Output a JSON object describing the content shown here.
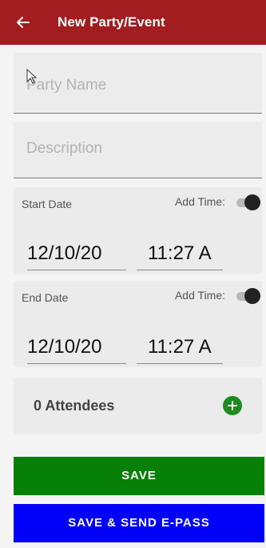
{
  "header": {
    "title": "New Party/Event",
    "back_icon": "arrow-left-icon",
    "color": "#a11d20"
  },
  "form": {
    "party_name": {
      "value": "",
      "placeholder": "Party Name"
    },
    "description": {
      "value": "",
      "placeholder": "Description"
    },
    "start": {
      "label": "Start Date",
      "add_time_label": "Add Time:",
      "add_time_on": true,
      "date": "12/10/20",
      "time": "11:27 A"
    },
    "end": {
      "label": "End Date",
      "add_time_label": "Add Time:",
      "add_time_on": true,
      "date": "12/10/20",
      "time": "11:27 A"
    },
    "attendees": {
      "label": "0 Attendees",
      "add_icon": "plus-icon"
    }
  },
  "buttons": {
    "save_label": "SAVE",
    "save_send_label": "SAVE & SEND E-PASS"
  },
  "colors": {
    "save": "#078007",
    "save_send": "#0000fa",
    "toggle_thumb": "#222222",
    "add": "#1d8b1d"
  }
}
